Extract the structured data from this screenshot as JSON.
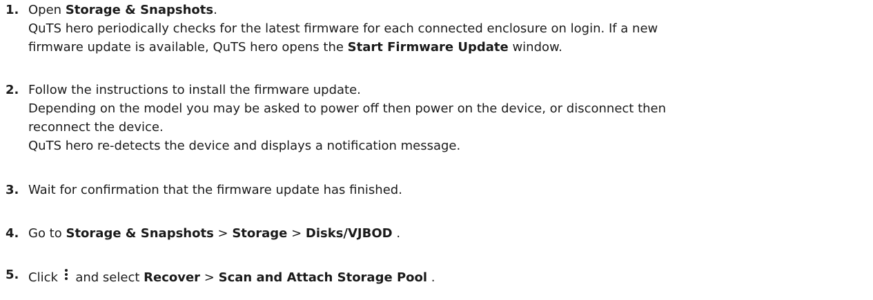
{
  "steps": [
    {
      "number": "1.",
      "open_prefix": "Open ",
      "open_target": "Storage & Snapshots",
      "open_suffix": ".",
      "detail_line1": "QuTS hero periodically checks for the latest firmware for each connected enclosure on login. If a new",
      "detail_line2_prefix": "firmware update is available, QuTS hero opens the ",
      "detail_line2_bold": "Start Firmware Update",
      "detail_line2_suffix": " window."
    },
    {
      "number": "2.",
      "line1": "Follow the instructions to install the firmware update.",
      "line2": "Depending on the model you may be asked to power off then power on the device, or disconnect then",
      "line3": "reconnect the device.",
      "line4": "QuTS hero re-detects the device and displays a notification message."
    },
    {
      "number": "3.",
      "line1": "Wait for confirmation that the firmware update has finished."
    },
    {
      "number": "4.",
      "prefix": "Go to ",
      "crumb1": "Storage & Snapshots",
      "sep1": " > ",
      "crumb2": "Storage",
      "sep2": " > ",
      "crumb3": "Disks/VJBOD",
      "suffix": " ."
    },
    {
      "number": "5.",
      "prefix": "Click ",
      "icon": "more-vertical-icon",
      "middle": " and select ",
      "crumb1": "Recover",
      "sep1": " > ",
      "crumb2": "Scan and Attach Storage Pool",
      "suffix": " ."
    }
  ]
}
